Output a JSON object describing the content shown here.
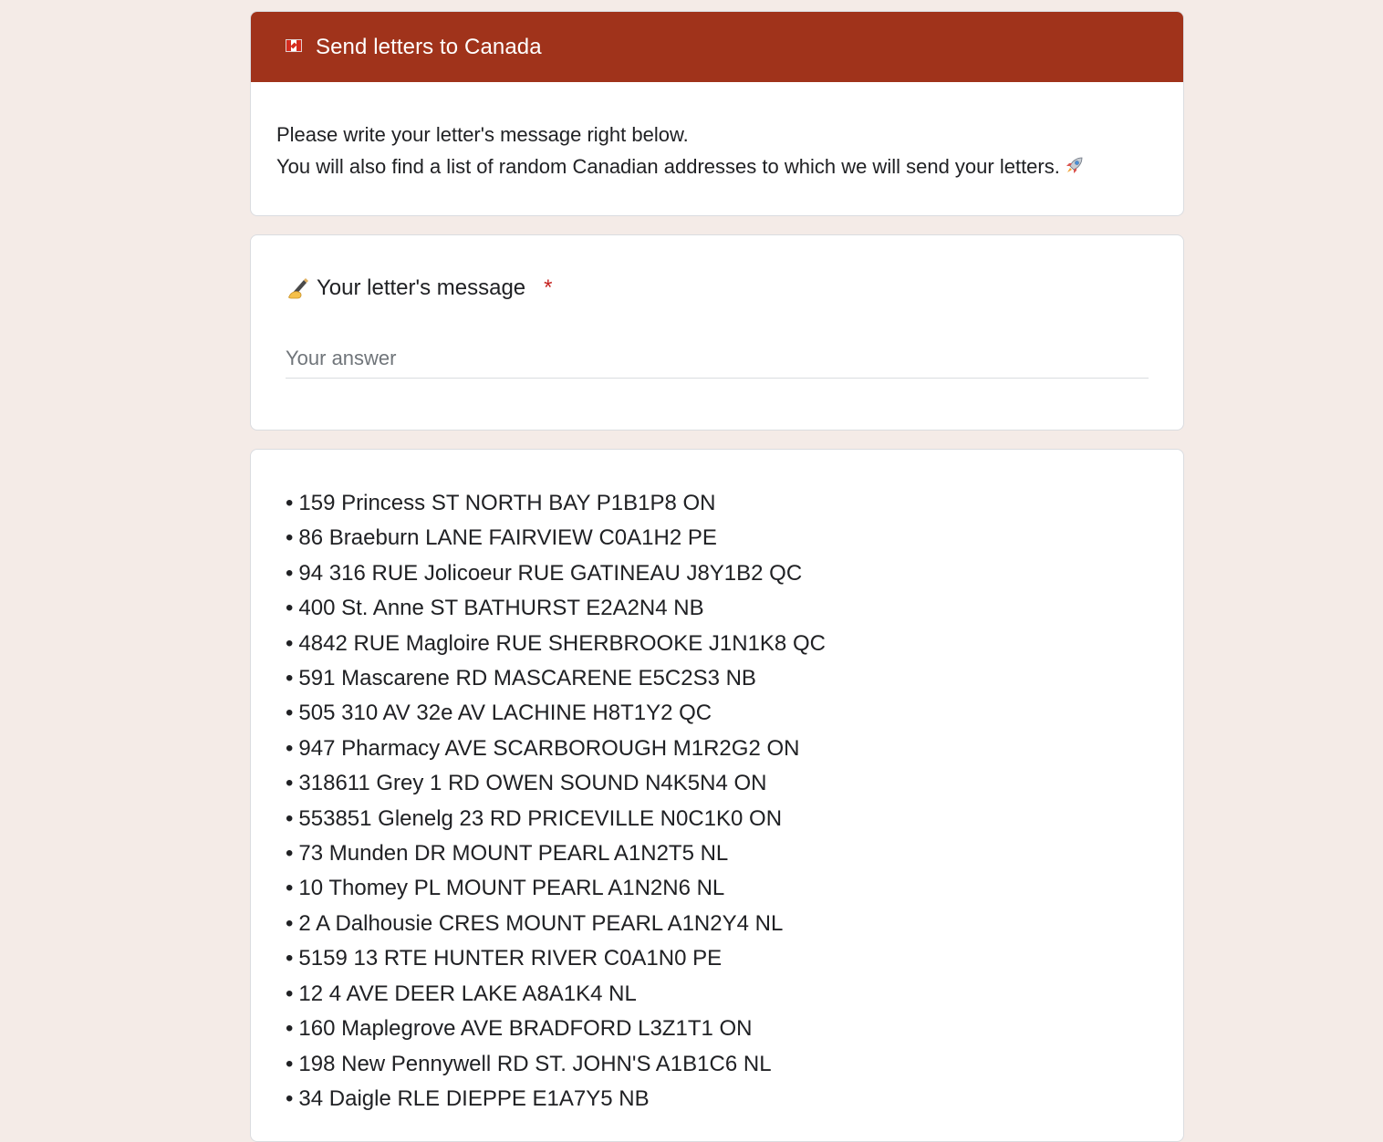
{
  "form": {
    "title": "Send letters to Canada",
    "title_icon": "canada-flag-icon",
    "description": {
      "line1": "Please write your letter's message right below.",
      "line2": "You will also find a list of random Canadian addresses to which we will send your letters.",
      "line2_icon": "rocket-icon"
    }
  },
  "question": {
    "icon": "writing-hand-icon",
    "label": "Your letter's message",
    "required_mark": "*",
    "placeholder": "Your answer",
    "value": ""
  },
  "addresses": {
    "bullet": "•",
    "items": [
      "159 Princess ST NORTH BAY P1B1P8 ON",
      "86 Braeburn LANE FAIRVIEW C0A1H2 PE",
      "94 316 RUE Jolicoeur RUE GATINEAU J8Y1B2 QC",
      "400 St. Anne ST BATHURST E2A2N4 NB",
      "4842 RUE Magloire RUE SHERBROOKE J1N1K8 QC",
      "591 Mascarene RD MASCARENE E5C2S3 NB",
      "505 310 AV 32e AV LACHINE H8T1Y2 QC",
      "947 Pharmacy AVE SCARBOROUGH M1R2G2 ON",
      "318611 Grey 1 RD OWEN SOUND N4K5N4 ON",
      "553851 Glenelg 23 RD PRICEVILLE N0C1K0 ON",
      "73 Munden DR MOUNT PEARL A1N2T5 NL",
      "10 Thomey PL MOUNT PEARL A1N2N6 NL",
      "2 A Dalhousie CRES MOUNT PEARL A1N2Y4 NL",
      "5159 13 RTE HUNTER RIVER C0A1N0 PE",
      "12 4 AVE DEER LAKE A8A1K4 NL",
      "160 Maplegrove AVE BRADFORD L3Z1T1 ON",
      "198 New Pennywell RD ST. JOHN'S A1B1C6 NL",
      "34 Daigle RLE DIEPPE E1A7Y5 NB"
    ]
  },
  "colors": {
    "page_background": "#f4ebe7",
    "header_banner": "#a0331b",
    "required": "#c5221f"
  }
}
